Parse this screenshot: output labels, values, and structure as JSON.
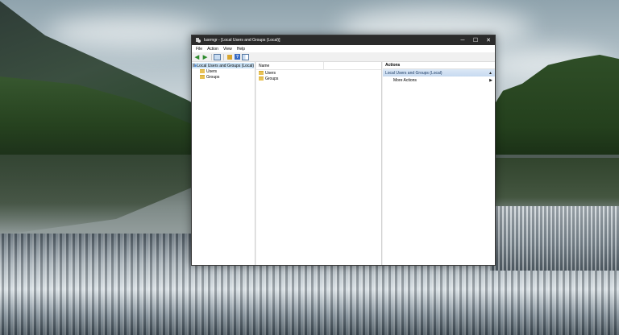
{
  "window": {
    "title": "lusrmgr - [Local Users and Groups (Local)]",
    "controls": {
      "minimize": "─",
      "maximize": "☐",
      "close": "✕"
    }
  },
  "menu": [
    "File",
    "Action",
    "View",
    "Help"
  ],
  "toolbar": {
    "icons": [
      "back-icon",
      "forward-icon",
      "show-hide-console-tree-icon",
      "export-list-icon",
      "help-icon",
      "show-hide-action-pane-icon"
    ],
    "glyphs": {
      "back": "◀",
      "forward": "▶",
      "help": "?"
    }
  },
  "tree": {
    "root": "Local Users and Groups (Local)",
    "children": [
      "Users",
      "Groups"
    ]
  },
  "list": {
    "column": "Name",
    "items": [
      "Users",
      "Groups"
    ]
  },
  "actions": {
    "header": "Actions",
    "group": "Local Users and Groups (Local)",
    "group_arrow": "▲",
    "items": [
      {
        "label": "More Actions",
        "arrow": "▶"
      }
    ]
  },
  "colors": {
    "titlebar": "#2b2b2b",
    "selection": "#cce4f7",
    "actions_group": "#c7daf0",
    "folder": "#e8c256"
  }
}
